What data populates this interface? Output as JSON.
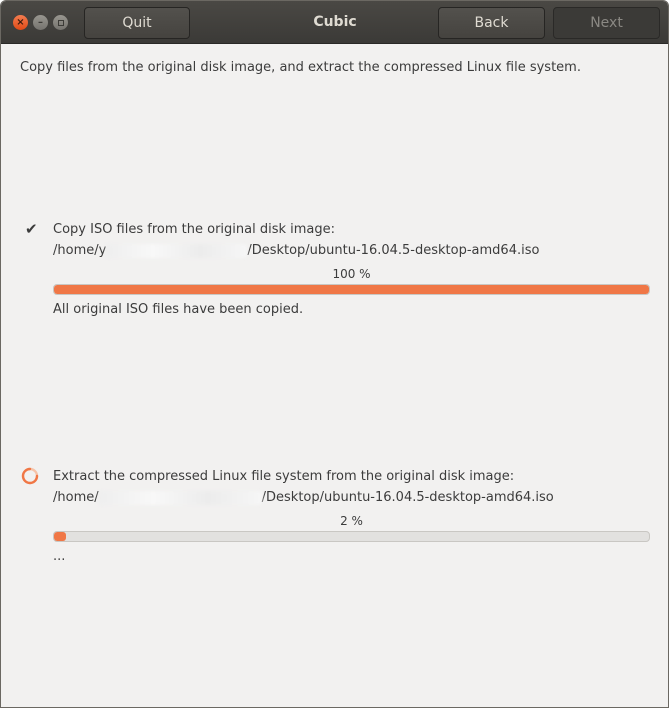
{
  "window": {
    "title": "Cubic",
    "buttons": {
      "quit": "Quit",
      "back": "Back",
      "next": "Next"
    }
  },
  "subtitle": "Copy files from the original disk image, and extract the compressed Linux file system.",
  "stages": [
    {
      "state": "done",
      "icon": "check-icon",
      "title": "Copy ISO files from the original disk image:",
      "path_prefix": "/home/y",
      "path_suffix": "/Desktop/ubuntu-16.04.5-desktop-amd64.iso",
      "percent_label": "100 %",
      "progress": 1.0,
      "status": "All original ISO files have been copied."
    },
    {
      "state": "running",
      "icon": "spinner-icon",
      "title": "Extract the compressed Linux file system from the original disk image:",
      "path_prefix": "/home/",
      "path_suffix": "/Desktop/ubuntu-16.04.5-desktop-amd64.iso",
      "percent_label": "2 %",
      "progress": 0.02,
      "status": "..."
    }
  ],
  "colors": {
    "accent": "#f07746",
    "header": "#3c3b37",
    "background": "#f2f1f0"
  }
}
